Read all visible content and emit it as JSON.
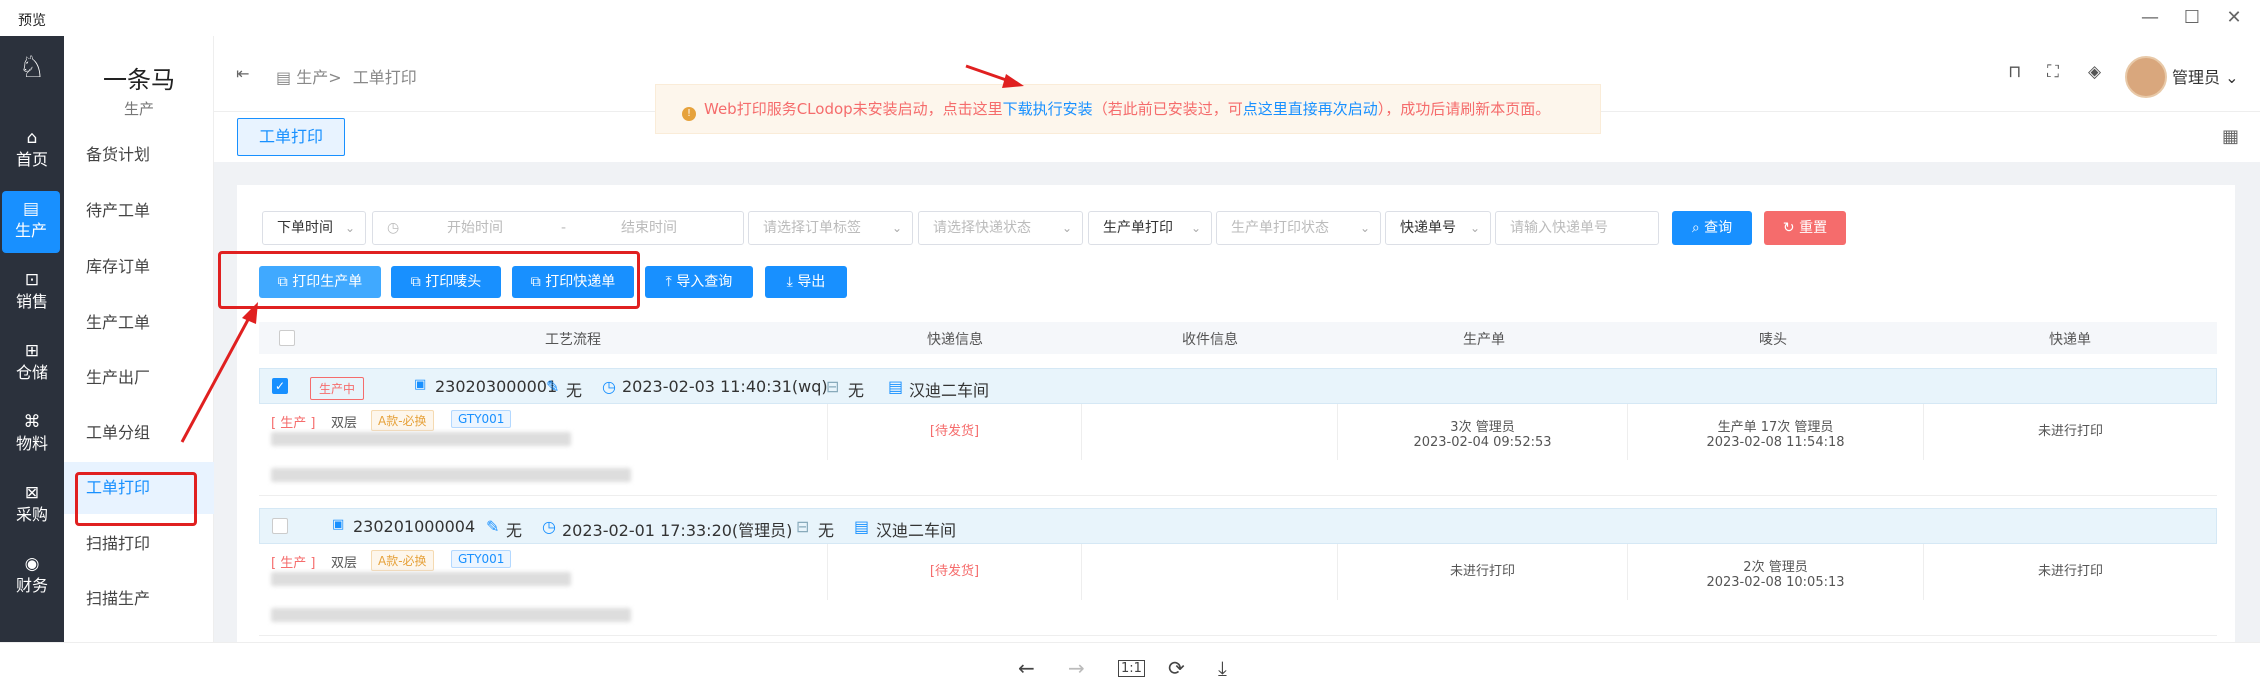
{
  "window": {
    "title": "预览"
  },
  "rail": [
    {
      "icon": "home-icon",
      "glyph": "⌂",
      "label": "首页"
    },
    {
      "icon": "production-icon",
      "glyph": "▤",
      "label": "生产"
    },
    {
      "icon": "sales-icon",
      "glyph": "⊡",
      "label": "销售"
    },
    {
      "icon": "warehouse-icon",
      "glyph": "⊞",
      "label": "仓储"
    },
    {
      "icon": "material-icon",
      "glyph": "⌘",
      "label": "物料"
    },
    {
      "icon": "purchase-icon",
      "glyph": "⊠",
      "label": "采购"
    },
    {
      "icon": "finance-icon",
      "glyph": "◉",
      "label": "财务"
    }
  ],
  "brand": {
    "name": "一条马",
    "sub": "生产"
  },
  "menu": [
    "备货计划",
    "待产工单",
    "库存订单",
    "生产工单",
    "生产出厂",
    "工单分组",
    "工单打印",
    "扫描打印",
    "扫描生产"
  ],
  "breadcrumb": {
    "parent": "生产>",
    "current": "工单打印"
  },
  "notice": {
    "prefix": "Web打印服务CLodop未安装启动，点击这里",
    "link1": "下载执行安装",
    "mid": "（若此前已安装过，可",
    "link2": "点这里直接再次启动",
    "suffix": "），成功后请刷新本页面。"
  },
  "user": {
    "name": "管理员"
  },
  "tab": "工单打印",
  "filters": {
    "order_time": "下单时间",
    "start": "开始时间",
    "sep": "-",
    "end": "结束时间",
    "order_tag": "请选择订单标签",
    "express_status": "请选择快递状态",
    "prod_print": "生产单打印",
    "prod_print_status": "生产单打印状态",
    "express_no_label": "快递单号",
    "express_no_ph": "请输入快递单号",
    "query": "查询",
    "reset": "重置"
  },
  "actions": {
    "print_prod": "打印生产单",
    "print_head": "打印唛头",
    "print_express": "打印快递单",
    "import_query": "导入查询",
    "export": "导出"
  },
  "table": {
    "headers": [
      "工艺流程",
      "快递信息",
      "收件信息",
      "生产单",
      "唛头",
      "快递单"
    ],
    "rows": [
      {
        "checked": true,
        "status": "生产中",
        "order_no": "230203000001",
        "note": "无",
        "time": "2023-02-03 11:40:31(wq)",
        "ship": "无",
        "workshop": "汉迪二车间",
        "tag1": "[ 生产 ]",
        "tag2": "双层",
        "tag3": "A款-必换",
        "tag4": "GTY001",
        "express": "[待发货]",
        "production": "3次 管理员",
        "production_time": "2023-02-04 09:52:53",
        "head": "生产单 17次 管理员",
        "head_time": "2023-02-08 11:54:18",
        "express_bill": "未进行打印"
      },
      {
        "checked": false,
        "status": "",
        "order_no": "230201000004",
        "note": "无",
        "time": "2023-02-01 17:33:20(管理员)",
        "ship": "无",
        "workshop": "汉迪二车间",
        "tag1": "[ 生产 ]",
        "tag2": "双层",
        "tag3": "A款-必换",
        "tag4": "GTY001",
        "express": "[待发货]",
        "production": "未进行打印",
        "production_time": "",
        "head": "2次 管理员",
        "head_time": "2023-02-08 10:05:13",
        "express_bill": "未进行打印"
      }
    ]
  },
  "colors": {
    "primary": "#1890ff",
    "danger": "#f56c6c",
    "rail": "#2b313c"
  }
}
